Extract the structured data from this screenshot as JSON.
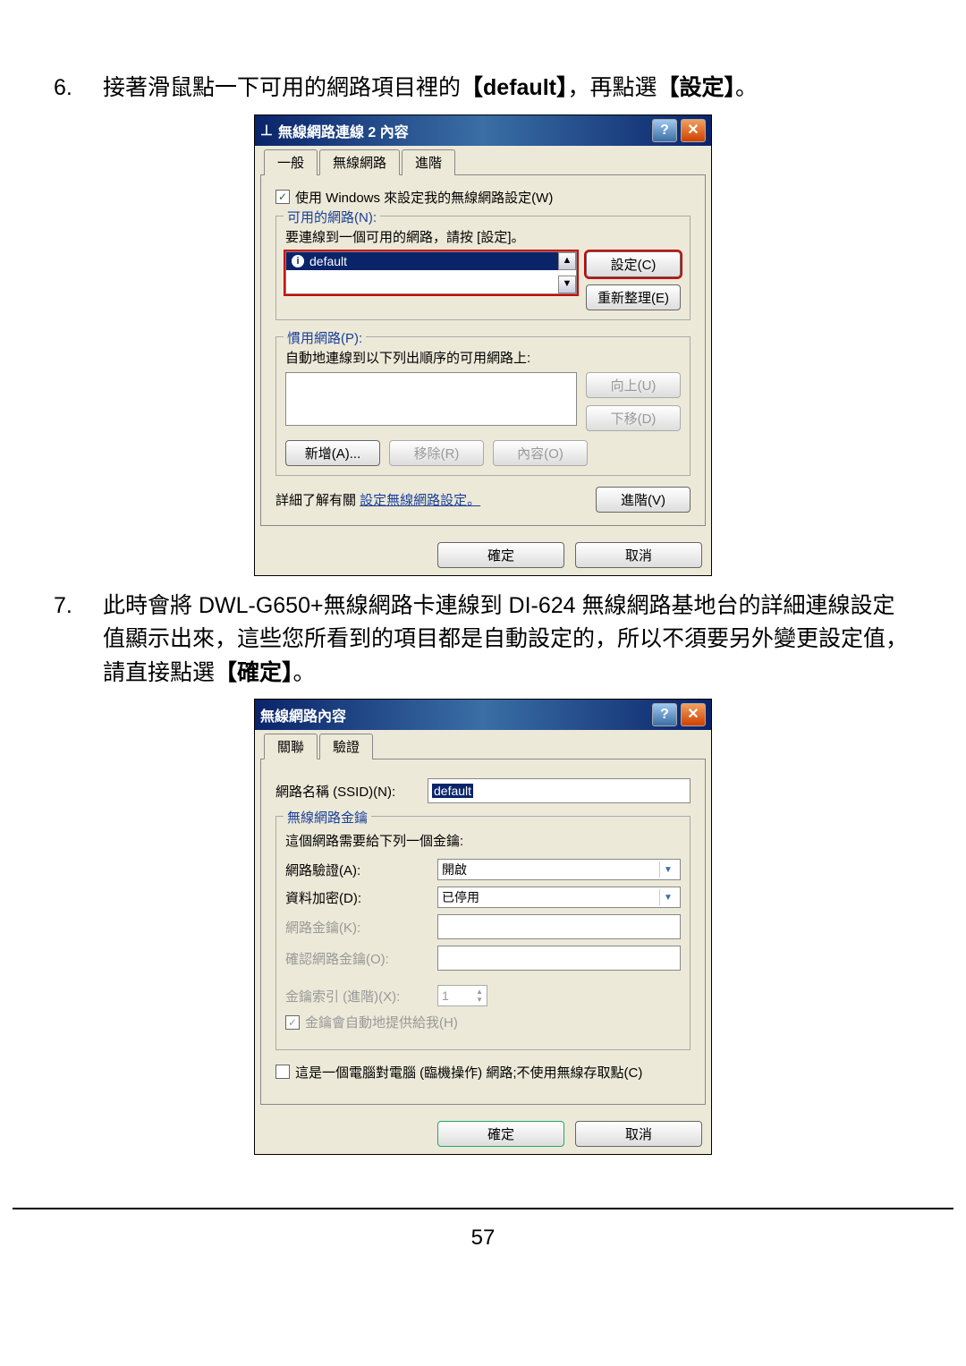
{
  "step6": {
    "num": "6.",
    "text_a": "接著滑鼠點一下可用的網路項目裡的",
    "text_b": "【default】",
    "text_c": "，再點選",
    "text_d": "【設定】",
    "text_e": "。"
  },
  "step7": {
    "num": "7.",
    "text_a": "此時會將 DWL-G650+無線網路卡連線到 DI-624 無線網路基地台的詳細連線設定值顯示出來，這些您所看到的項目都是自動設定的，所以不須要另外變更設定值，請直接點選",
    "text_b": "【確定】",
    "text_c": "。"
  },
  "dlg1": {
    "title": "無線網路連線 2 內容",
    "tabs": {
      "general": "一般",
      "wireless": "無線網路",
      "advanced": "進階"
    },
    "use_windows": "使用 Windows 來設定我的無線網路設定(W)",
    "avail_group": {
      "legend": "可用的網路(N):",
      "desc": "要連線到一個可用的網路，請按 [設定]。",
      "list_item": "default",
      "btn_config": "設定(C)",
      "btn_refresh": "重新整理(E)"
    },
    "pref_group": {
      "legend": "慣用網路(P):",
      "desc": "自動地連線到以下列出順序的可用網路上:",
      "btn_up": "向上(U)",
      "btn_down": "下移(D)",
      "btn_add": "新增(A)...",
      "btn_remove": "移除(R)",
      "btn_prop": "內容(O)"
    },
    "detail_pre": "詳細了解有關 ",
    "detail_link": "設定無線網路設定。",
    "btn_adv": "進階(V)",
    "btn_ok": "確定",
    "btn_cancel": "取消"
  },
  "dlg2": {
    "title": "無線網路內容",
    "tabs": {
      "assoc": "關聯",
      "auth": "驗證"
    },
    "ssid_label": "網路名稱 (SSID)(N):",
    "ssid_value": "default",
    "key_group": {
      "legend": "無線網路金鑰",
      "desc": "這個網路需要給下列一個金鑰:",
      "auth_label": "網路驗證(A):",
      "auth_value": "開啟",
      "enc_label": "資料加密(D):",
      "enc_value": "已停用",
      "key_label": "網路金鑰(K):",
      "key_confirm_label": "確認網路金鑰(O):",
      "key_index_label": "金鑰索引 (進階)(X):",
      "key_index_value": "1",
      "auto_key": "金鑰會自動地提供給我(H)"
    },
    "adhoc": "這是一個電腦對電腦 (臨機操作) 網路;不使用無線存取點(C)",
    "btn_ok": "確定",
    "btn_cancel": "取消"
  },
  "page_number": "57"
}
